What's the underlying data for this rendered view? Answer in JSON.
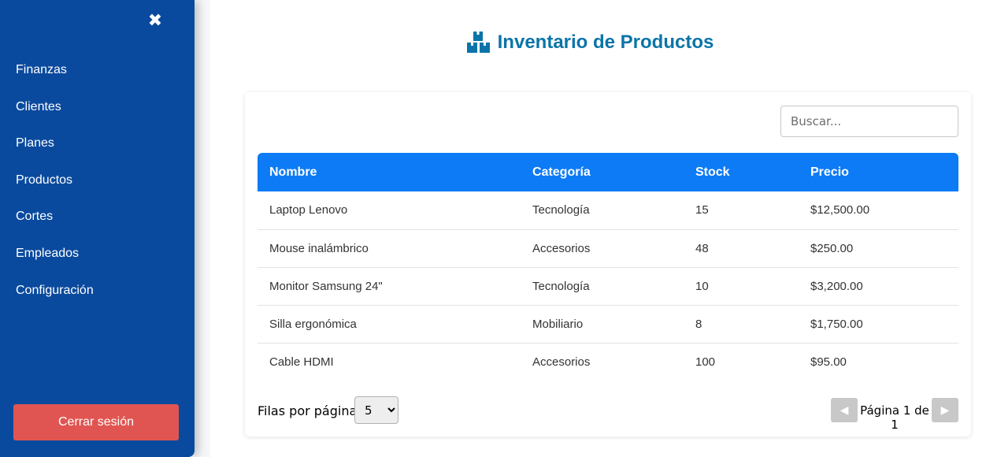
{
  "sidebar": {
    "items": [
      {
        "label": "Finanzas"
      },
      {
        "label": "Clientes"
      },
      {
        "label": "Planes"
      },
      {
        "label": "Productos"
      },
      {
        "label": "Cortes"
      },
      {
        "label": "Empleados"
      },
      {
        "label": "Configuración"
      }
    ],
    "close_icon": "✖",
    "logout_label": "Cerrar sesión"
  },
  "page": {
    "title": "Inventario de Productos",
    "title_icon": "boxes-icon"
  },
  "search": {
    "placeholder": "Buscar..."
  },
  "table": {
    "headers": [
      "Nombre",
      "Categoría",
      "Stock",
      "Precio"
    ],
    "rows": [
      [
        "Laptop Lenovo",
        "Tecnología",
        "15",
        "$12,500.00"
      ],
      [
        "Mouse inalámbrico",
        "Accesorios",
        "48",
        "$250.00"
      ],
      [
        "Monitor Samsung 24\"",
        "Tecnología",
        "10",
        "$3,200.00"
      ],
      [
        "Silla ergonómica",
        "Mobiliario",
        "8",
        "$1,750.00"
      ],
      [
        "Cable HDMI",
        "Accesorios",
        "100",
        "$95.00"
      ]
    ]
  },
  "pagination": {
    "rows_label": "Filas por página:",
    "rows_value": "5",
    "page_info": "Página 1 de 1",
    "prev_symbol": "◀",
    "next_symbol": "▶"
  },
  "colors": {
    "sidebar_bg": "#0a4a9e",
    "header_bg": "#0d7bf5",
    "title": "#0b74a8",
    "logout_bg": "#e05551"
  }
}
